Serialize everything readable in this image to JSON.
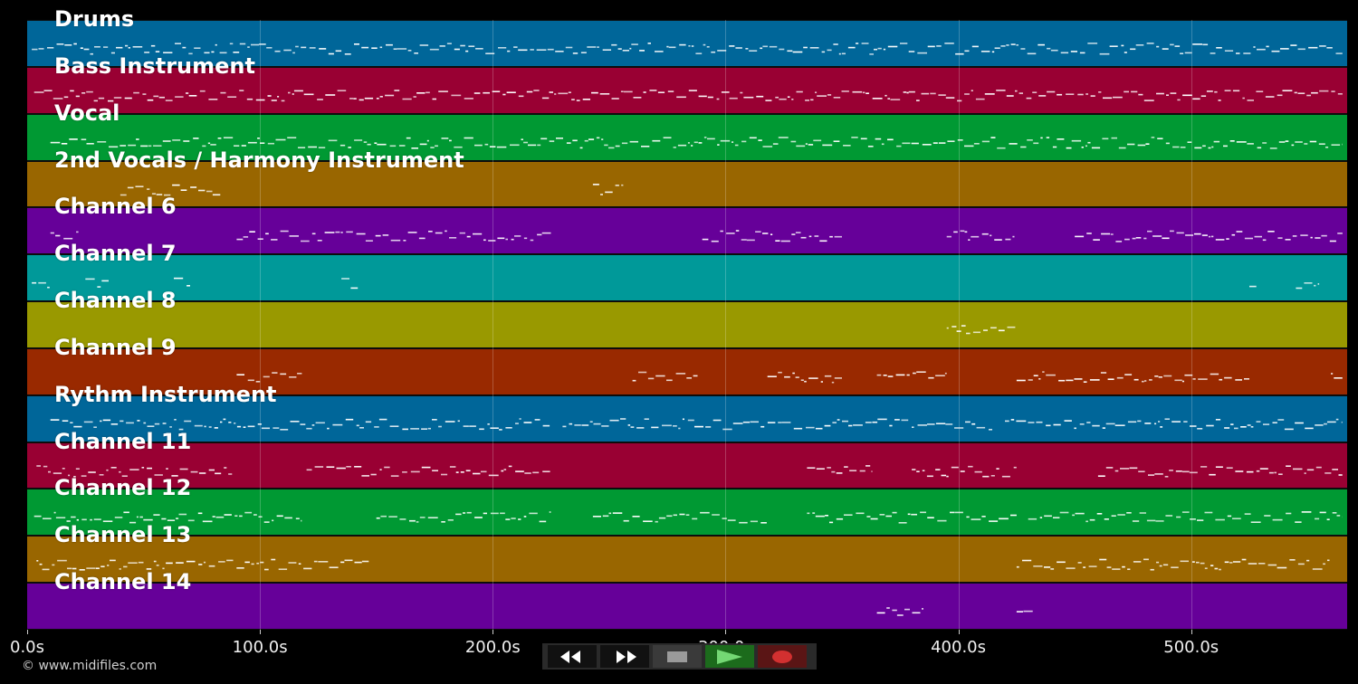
{
  "tracks": [
    {
      "name": "Drums",
      "color": "#006699"
    },
    {
      "name": "Bass Instrument",
      "color": "#990033"
    },
    {
      "name": "Vocal",
      "color": "#009933"
    },
    {
      "name": "2nd Vocals / Harmony Instrument",
      "color": "#996600"
    },
    {
      "name": "Channel 6",
      "color": "#660099"
    },
    {
      "name": "Channel 7",
      "color": "#009999"
    },
    {
      "name": "Channel 8",
      "color": "#999900"
    },
    {
      "name": "Channel 9",
      "color": "#992900"
    },
    {
      "name": "Rythm Instrument",
      "color": "#006699"
    },
    {
      "name": "Channel 11",
      "color": "#990033"
    },
    {
      "name": "Channel 12",
      "color": "#009933"
    },
    {
      "name": "Channel 13",
      "color": "#996600"
    },
    {
      "name": "Channel 14",
      "color": "#660099"
    }
  ],
  "timeline": {
    "ticks": [
      "0.0s",
      "100.0s",
      "200.0s",
      "300.0s",
      "400.0s",
      "500.0s"
    ],
    "tick_values": [
      0,
      100,
      200,
      300,
      400,
      500
    ],
    "max_seconds": 567
  },
  "copyright": "© www.midifiles.com",
  "transport": {
    "rewind": "rewind-icon",
    "fast_forward": "fast-forward-icon",
    "stop": "stop-icon",
    "play": "play-icon",
    "record": "record-icon"
  },
  "qr_color": "#ffe033",
  "qr_dark": "#5a0a5a"
}
